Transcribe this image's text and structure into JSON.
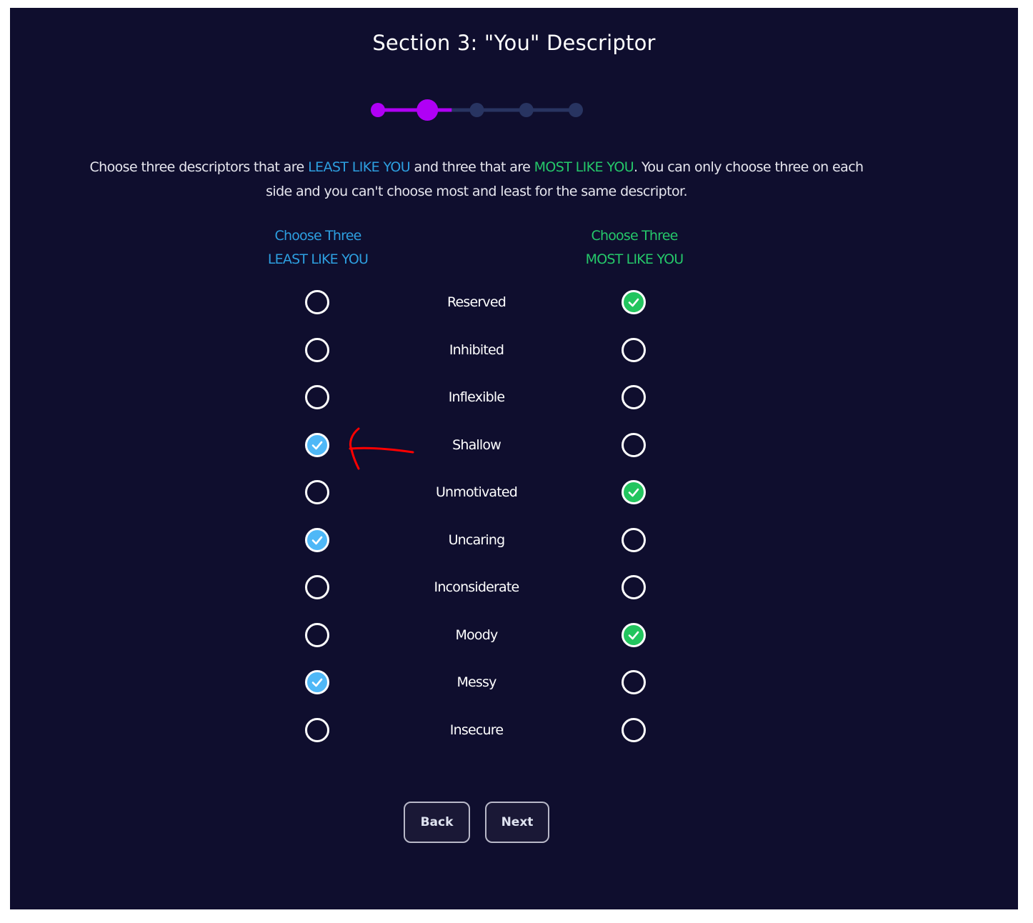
{
  "page": {
    "title": "Section 3: \"You\" Descriptor"
  },
  "stepper": {
    "total_steps": 5,
    "current_step": 2,
    "active_color": "#b000f5",
    "inactive_color": "#283461"
  },
  "instructions": {
    "part1": "Choose three descriptors that are ",
    "least_text": "LEAST LIKE YOU",
    "part2": " and three that are ",
    "most_text": "MOST LIKE YOU",
    "part3": ". You can only choose three on each side and you can't choose most and least for the same descriptor."
  },
  "columns": {
    "least": {
      "line1": "Choose Three",
      "line2": "LEAST LIKE YOU",
      "color": "#2d9fe0"
    },
    "most": {
      "line1": "Choose Three",
      "line2": "MOST LIKE YOU",
      "color": "#25c86a"
    }
  },
  "descriptors": [
    {
      "label": "Reserved",
      "least": false,
      "most": true
    },
    {
      "label": "Inhibited",
      "least": false,
      "most": false
    },
    {
      "label": "Inflexible",
      "least": false,
      "most": false
    },
    {
      "label": "Shallow",
      "least": true,
      "most": false
    },
    {
      "label": "Unmotivated",
      "least": false,
      "most": true
    },
    {
      "label": "Uncaring",
      "least": true,
      "most": false
    },
    {
      "label": "Inconsiderate",
      "least": false,
      "most": false
    },
    {
      "label": "Moody",
      "least": false,
      "most": true
    },
    {
      "label": "Messy",
      "least": true,
      "most": false
    },
    {
      "label": "Insecure",
      "least": false,
      "most": false
    }
  ],
  "buttons": {
    "back": "Back",
    "next": "Next"
  },
  "annotation": {
    "type": "red-arrow",
    "points_to": "Shallow least-like-you checkbox",
    "color": "#ff0000"
  }
}
